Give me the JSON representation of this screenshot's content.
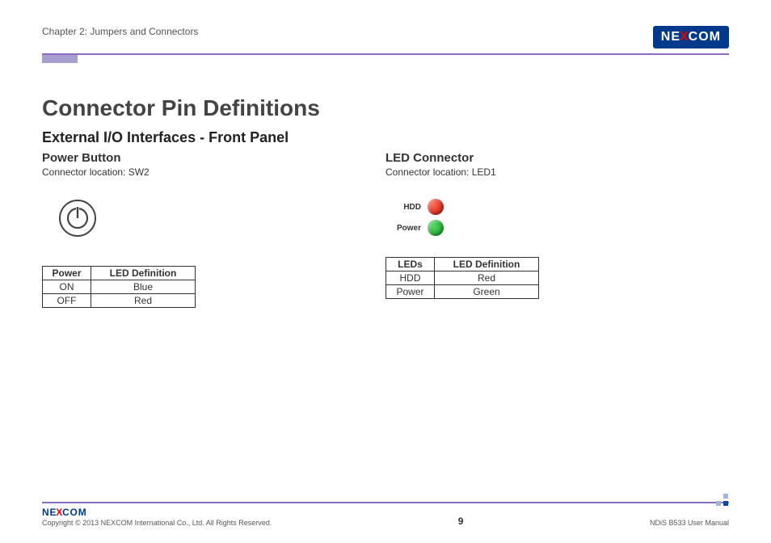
{
  "header": {
    "chapter": "Chapter 2: Jumpers and Connectors",
    "brand_pre": "NE",
    "brand_x": "X",
    "brand_post": "COM"
  },
  "title": "Connector Pin Definitions",
  "subtitle": "External I/O Interfaces - Front Panel",
  "left": {
    "heading": "Power Button",
    "location": "Connector location: SW2",
    "table": {
      "col1": "Power",
      "col2": "LED Definition",
      "rows": [
        {
          "c1": "ON",
          "c2": "Blue"
        },
        {
          "c1": "OFF",
          "c2": "Red"
        }
      ]
    }
  },
  "right": {
    "heading": "LED Connector",
    "location": "Connector location: LED1",
    "led_labels": {
      "hdd": "HDD",
      "power": "Power"
    },
    "table": {
      "col1": "LEDs",
      "col2": "LED Definition",
      "rows": [
        {
          "c1": "HDD",
          "c2": "Red"
        },
        {
          "c1": "Power",
          "c2": "Green"
        }
      ]
    }
  },
  "footer": {
    "copyright": "Copyright © 2013 NEXCOM International Co., Ltd. All Rights Reserved.",
    "page": "9",
    "manual": "NDiS B533 User Manual"
  }
}
